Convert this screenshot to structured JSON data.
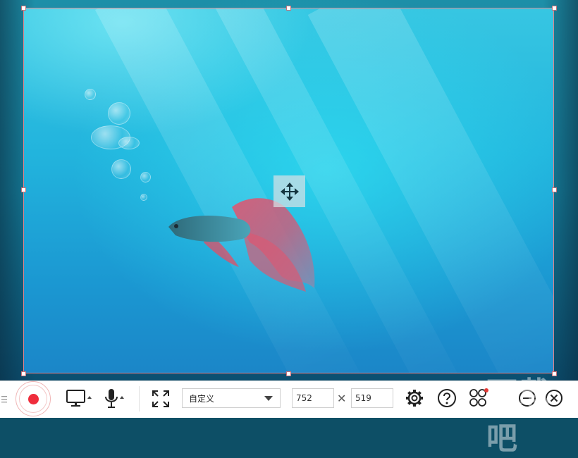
{
  "toolbar": {
    "grip_icon": "drag-grip-icon",
    "record_icon": "record-icon",
    "screen_icon": "monitor-icon",
    "mic_icon": "microphone-icon",
    "fullscreen_icon": "fullscreen-icon",
    "preset": {
      "selected": "自定义"
    },
    "width_value": "752",
    "height_value": "519",
    "times_sign": "✕",
    "settings_icon": "gear-icon",
    "help_icon": "question-icon",
    "tools_icon": "toolbox-icon",
    "minimize_icon": "minimize-icon",
    "close_icon": "close-icon"
  },
  "region": {
    "move_icon": "move-arrows-icon"
  },
  "colors": {
    "record": "#ef2d3c",
    "region_border": "#e0828a"
  },
  "watermark": "下载吧"
}
